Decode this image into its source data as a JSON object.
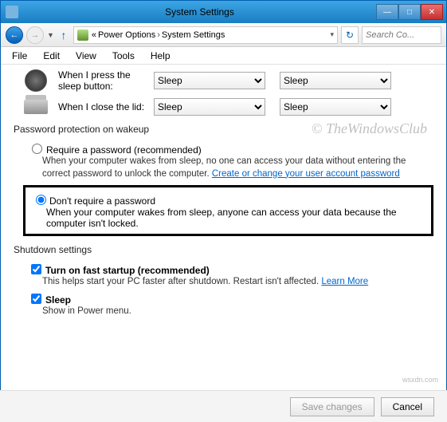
{
  "window": {
    "title": "System Settings"
  },
  "breadcrumb": {
    "part1": "Power Options",
    "part2": "System Settings"
  },
  "search": {
    "placeholder": "Search Co..."
  },
  "menu": {
    "file": "File",
    "edit": "Edit",
    "view": "View",
    "tools": "Tools",
    "help": "Help"
  },
  "rows": {
    "sleep": {
      "label": "When I press the sleep button:",
      "opt1": "Sleep",
      "opt2": "Sleep"
    },
    "lid": {
      "label": "When I close the lid:",
      "opt1": "Sleep",
      "opt2": "Sleep"
    }
  },
  "pwd": {
    "section": "Password protection on wakeup",
    "req_label": "Require a password (recommended)",
    "req_desc1": "When your computer wakes from sleep, no one can access your data without entering the correct password to unlock the computer. ",
    "req_link": "Create or change your user account password",
    "no_label": "Don't require a password",
    "no_desc": "When your computer wakes from sleep, anyone can access your data because the computer isn't locked."
  },
  "shutdown": {
    "section": "Shutdown settings",
    "fast_label": "Turn on fast startup (recommended)",
    "fast_desc": "This helps start your PC faster after shutdown. Restart isn't affected. ",
    "fast_link": "Learn More",
    "sleep_label": "Sleep",
    "sleep_desc": "Show in Power menu."
  },
  "footer": {
    "save": "Save changes",
    "cancel": "Cancel"
  },
  "watermark": "© TheWindowsClub",
  "credit": "wsxdn.com"
}
